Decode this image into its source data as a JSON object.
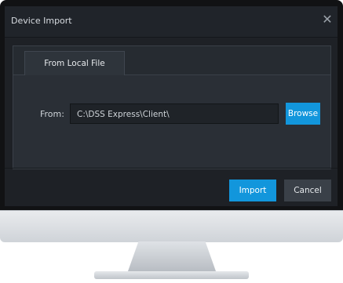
{
  "dialog": {
    "title": "Device Import",
    "close_icon": "close-icon"
  },
  "tabs": [
    {
      "label": "From Local File",
      "active": true
    }
  ],
  "form": {
    "from_label": "From:",
    "path_value": "C:\\DSS Express\\Client\\",
    "browse_label": "Browse"
  },
  "actions": {
    "import_label": "Import",
    "cancel_label": "Cancel"
  },
  "colors": {
    "accent": "#1296dc",
    "panel": "#2a2f36",
    "screen_bg": "#1e2126",
    "bezel": "#111214"
  }
}
